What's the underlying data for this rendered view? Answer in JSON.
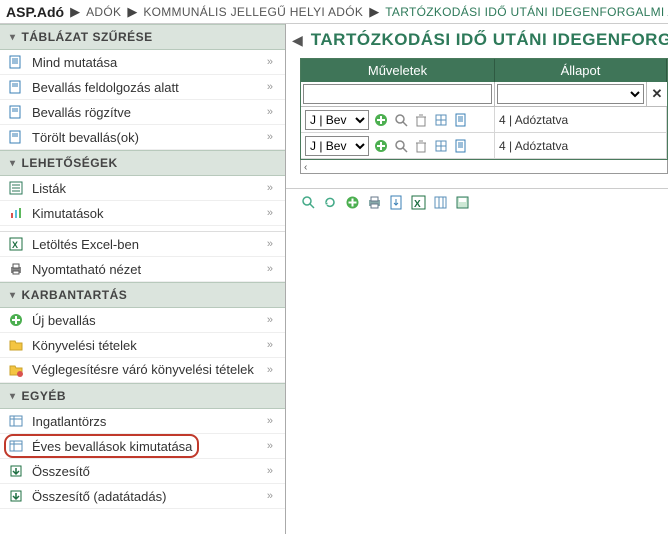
{
  "breadcrumb": {
    "root": "ASP.Adó",
    "items": [
      "ADÓK",
      "KOMMUNÁLIS JELLEGŰ HELYI ADÓK",
      "TARTÓZKODÁSI IDŐ UTÁNI IDEGENFORGALMI ADÓ"
    ]
  },
  "sidebar": {
    "sections": {
      "filter": {
        "title": "TÁBLÁZAT SZŰRÉSE"
      },
      "options": {
        "title": "LEHETŐSÉGEK"
      },
      "maint": {
        "title": "KARBANTARTÁS"
      },
      "other": {
        "title": "EGYÉB"
      }
    },
    "filter_items": [
      {
        "label": "Mind mutatása"
      },
      {
        "label": "Bevallás feldolgozás alatt"
      },
      {
        "label": "Bevallás rögzítve"
      },
      {
        "label": "Törölt bevallás(ok)"
      }
    ],
    "options_items_a": [
      {
        "label": "Listák"
      },
      {
        "label": "Kimutatások"
      }
    ],
    "options_items_b": [
      {
        "label": "Letöltés Excel-ben"
      },
      {
        "label": "Nyomtatható nézet"
      }
    ],
    "maint_items": [
      {
        "label": "Új bevallás"
      },
      {
        "label": "Könyvelési tételek"
      },
      {
        "label": "Véglegesítésre váró könyvelési tételek"
      }
    ],
    "other_items": [
      {
        "label": "Ingatlantörzs"
      },
      {
        "label": "Éves bevallások kimutatása"
      },
      {
        "label": "Összesítő"
      },
      {
        "label": "Összesítő (adatátadás)"
      }
    ]
  },
  "main": {
    "title": "TARTÓZKODÁSI IDŐ UTÁNI IDEGENFORGALMI",
    "columns": {
      "ops": "Műveletek",
      "state": "Állapot"
    },
    "row_action_select": "J | Bev",
    "rows": [
      {
        "state": "4 | Adóztatva"
      },
      {
        "state": "4 | Adóztatva"
      }
    ],
    "filter_ops_value": "",
    "filter_state_value": ""
  }
}
